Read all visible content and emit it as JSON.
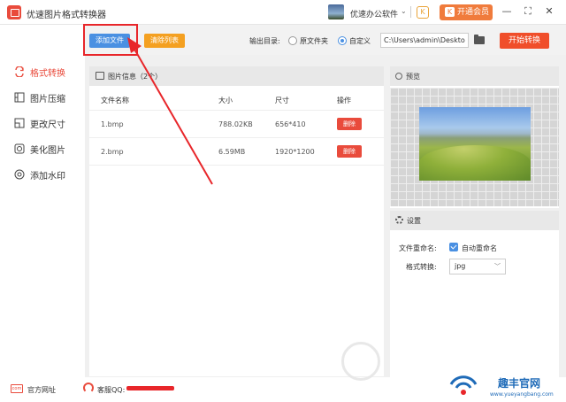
{
  "window": {
    "title": "优速图片格式转换器",
    "vendor_label": "优速办公软件",
    "vip_label": "开通会员",
    "vip_icon": "K",
    "minimize_icon": "—",
    "restore_icon": "⛶",
    "close_icon": "✕"
  },
  "sidebar": {
    "items": [
      {
        "label": "格式转换",
        "active": true
      },
      {
        "label": "图片压缩",
        "active": false
      },
      {
        "label": "更改尺寸",
        "active": false
      },
      {
        "label": "美化图片",
        "active": false
      },
      {
        "label": "添加水印",
        "active": false
      }
    ]
  },
  "toolbar": {
    "add_file_label": "添加文件",
    "clear_list_label": "清除列表",
    "output_label": "输出目录:",
    "option_original": "原文件夹",
    "option_custom": "自定义",
    "path_value": "C:\\Users\\admin\\Deskto",
    "start_label": "开始转换"
  },
  "file_panel": {
    "title": "图片信息（2个）",
    "columns": {
      "name": "文件名称",
      "size": "大小",
      "dimensions": "尺寸",
      "action": "操作"
    },
    "rows": [
      {
        "name": "1.bmp",
        "size": "788.02KB",
        "dimensions": "656*410",
        "action": "删除"
      },
      {
        "name": "2.bmp",
        "size": "6.59MB",
        "dimensions": "1920*1200",
        "action": "删除"
      }
    ]
  },
  "preview": {
    "title": "预览"
  },
  "settings": {
    "title": "设置",
    "rename_label": "文件重命名:",
    "rename_option": "自动重命名",
    "rename_checked": true,
    "format_label": "格式转换:",
    "format_value": "jpg",
    "format_caret": "﹀"
  },
  "footer": {
    "website_label": "官方网址",
    "website_icon_text": "com",
    "support_label": "客服QQ:"
  },
  "watermark": {
    "text": "趣丰官网",
    "url": "www.yueyangbang.com"
  },
  "colors": {
    "accent": "#e94b3c",
    "primary_blue": "#4a90e2",
    "orange": "#f4a021",
    "highlight_red": "#e8262a"
  }
}
